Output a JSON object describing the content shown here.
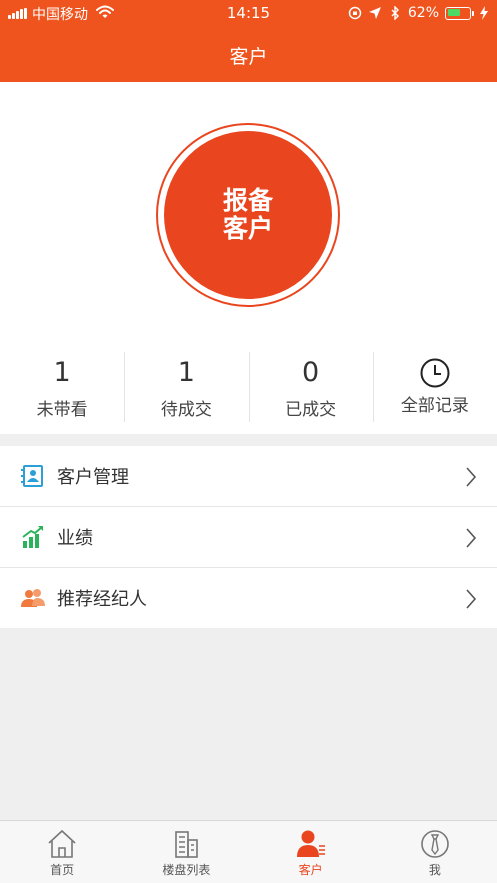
{
  "status_bar": {
    "carrier": "中国移动",
    "time": "14:15",
    "battery_percent": "62%",
    "battery_level": 0.62
  },
  "nav": {
    "title": "客户"
  },
  "hero": {
    "button_line1": "报备",
    "button_line2": "客户"
  },
  "stats": [
    {
      "value": "1",
      "label": "未带看"
    },
    {
      "value": "1",
      "label": "待成交"
    },
    {
      "value": "0",
      "label": "已成交"
    },
    {
      "icon": "clock-icon",
      "label": "全部记录"
    }
  ],
  "menu": [
    {
      "label": "客户管理",
      "icon": "contacts-icon",
      "color": "#2a9fd8"
    },
    {
      "label": "业绩",
      "icon": "growth-chart-icon",
      "color": "#2bb35c"
    },
    {
      "label": "推荐经纪人",
      "icon": "people-icon",
      "color": "#f07a3e"
    }
  ],
  "tabs": [
    {
      "label": "首页",
      "icon": "home-icon"
    },
    {
      "label": "楼盘列表",
      "icon": "building-icon"
    },
    {
      "label": "客户",
      "icon": "customer-icon",
      "active": true
    },
    {
      "label": "我",
      "icon": "profile-tie-icon"
    }
  ],
  "colors": {
    "brand": "#f0541e",
    "accent": "#e9461f"
  }
}
